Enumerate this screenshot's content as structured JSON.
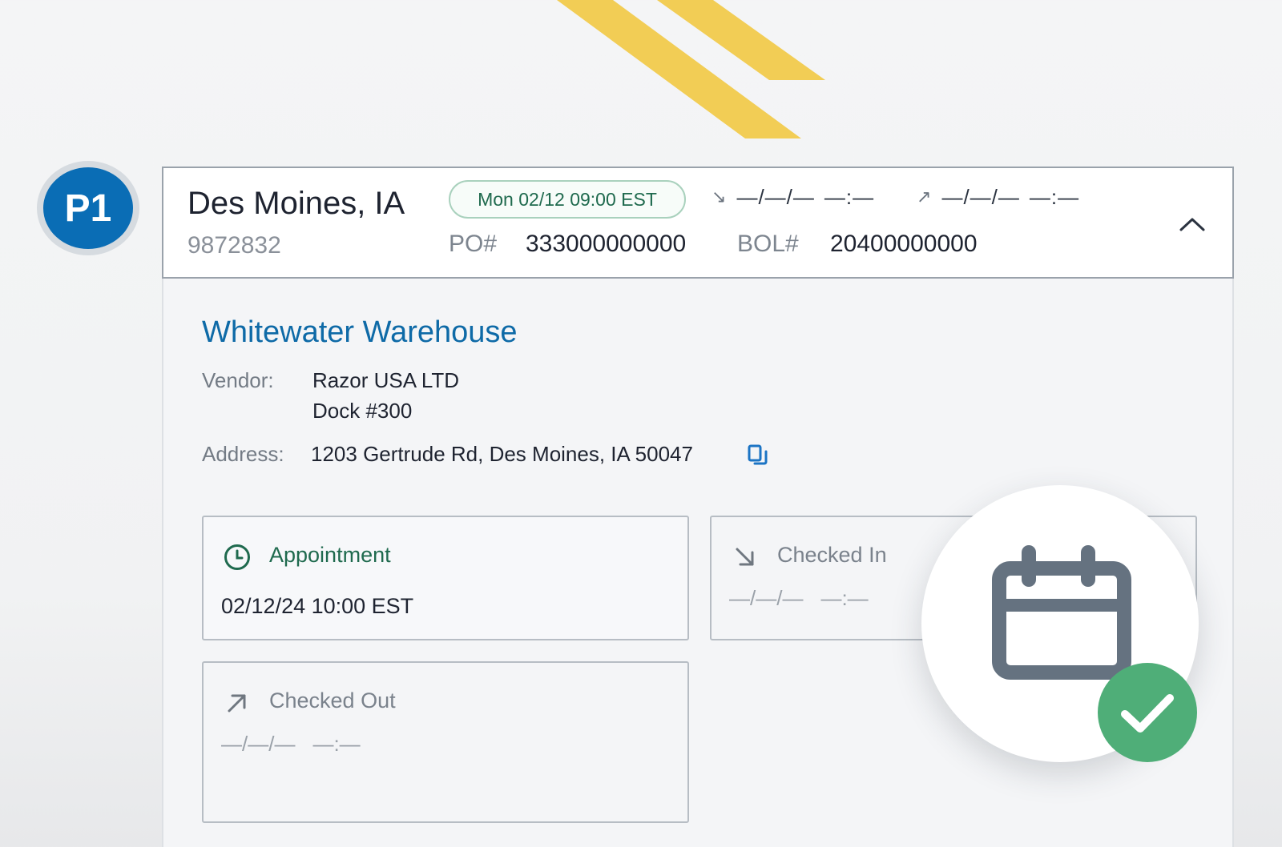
{
  "badge": {
    "label": "P1"
  },
  "header": {
    "city": "Des Moines, IA",
    "stop_id": "9872832",
    "appointment_pill": "Mon 02/12 09:00 EST",
    "checked_in": {
      "date": "—/—/—",
      "time": "—:—"
    },
    "checked_out": {
      "date": "—/—/—",
      "time": "—:—"
    },
    "po_label": "PO#",
    "po_value": "333000000000",
    "bol_label": "BOL#",
    "bol_value": "20400000000",
    "collapse_icon": "chevron-up-icon"
  },
  "details": {
    "warehouse": "Whitewater Warehouse",
    "vendor_label": "Vendor:",
    "vendor_name": "Razor USA LTD",
    "vendor_dock": "Dock #300",
    "address_label": "Address:",
    "address_value": "1203 Gertrude Rd, Des Moines, IA 50047",
    "copy_icon": "copy-icon"
  },
  "boxes": {
    "appointment": {
      "title": "Appointment",
      "value": "02/12/24 10:00 EST",
      "icon": "clock-icon"
    },
    "checked_in": {
      "title": "Checked In",
      "date": "—/—/—",
      "time": "—:—",
      "icon": "arrow-down-right-icon"
    },
    "checked_out": {
      "title": "Checked Out",
      "date": "—/—/—",
      "time": "—:—",
      "icon": "arrow-up-right-icon"
    }
  },
  "overlay": {
    "icon": "calendar-icon",
    "badge_icon": "checkmark-icon"
  },
  "colors": {
    "brand_blue": "#0a6db5",
    "accent_green": "#1f6a4e",
    "success_green": "#4fae78",
    "stripe_yellow": "#f2cd55"
  }
}
